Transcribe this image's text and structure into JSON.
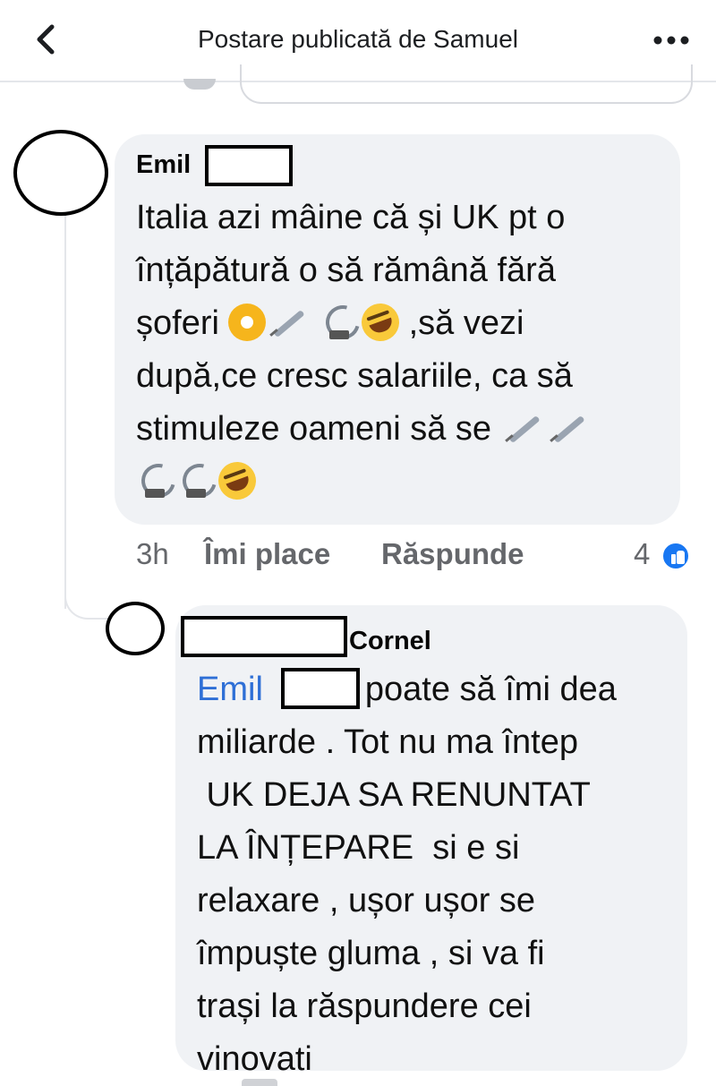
{
  "header": {
    "title": "Postare publicată de Samuel",
    "back_icon": "chevron-left-icon",
    "more_icon": "more-horizontal-icon"
  },
  "comments": [
    {
      "author": "Emil",
      "lines": [
        "Italia azi mâine că și UK pt o",
        "înțăpătură o să rămână fără",
        "șoferi",
        ",să vezi",
        "după,ce cresc salariile, ca să",
        "stimuleze oameni să se"
      ],
      "emoji": [
        "radioactive",
        "syringe",
        "satellite-antenna",
        "rofl"
      ],
      "time": "3h",
      "like_label": "Îmi place",
      "reply_label": "Răspunde",
      "reaction_count": "4",
      "reaction_icon": "like-icon"
    },
    {
      "author": "Cornel",
      "mention": "Emil",
      "lines": [
        "poate să îmi dea",
        "miliarde . Tot nu ma întep",
        " UK DEJA SA RENUNTAT",
        "LA ÎNȚEPARE  si e si",
        "relaxare , ușor ușor se",
        "împuște gluma , si va fi",
        "trași la răspundere cei",
        "vinovati"
      ]
    }
  ]
}
